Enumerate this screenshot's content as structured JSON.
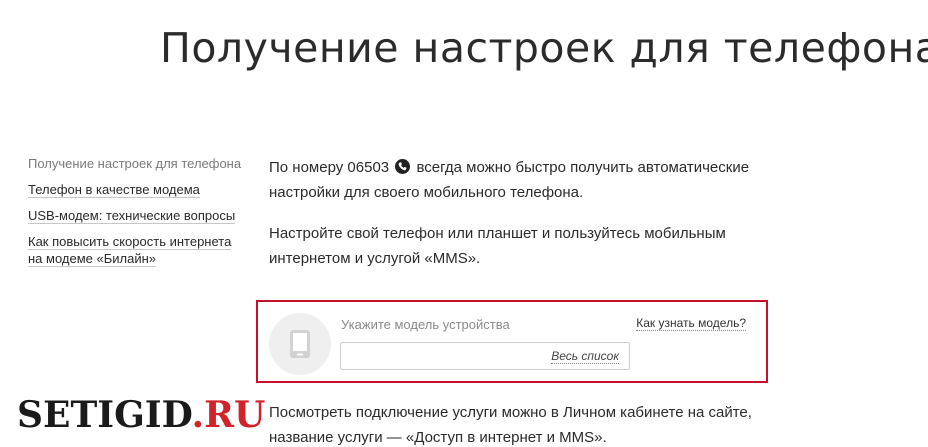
{
  "page": {
    "title": "Получение настроек для телефона"
  },
  "sidebar": {
    "items": [
      {
        "label": "Получение настроек для телефона",
        "active": true
      },
      {
        "label": "Телефон в качестве модема",
        "active": false
      },
      {
        "label": "USB-модем: технические вопросы",
        "active": false
      },
      {
        "label_line1": "Как повысить скорость интернета",
        "label_line2": "на модеме «Билайн»",
        "active": false
      }
    ]
  },
  "main": {
    "para1_before": "По номеру 06503",
    "para1_icon": "phone-icon",
    "para1_after": "всегда можно быстро получить автоматические",
    "para1_line2": "настройки для своего мобильного телефона.",
    "para2_line1": "Настройте свой телефон или планшет и пользуйтесь мобильным",
    "para2_line2": "интернетом и услугой «MMS»."
  },
  "chooser": {
    "icon": "smartphone-icon",
    "label": "Укажите модель устройства",
    "help_link": "Как узнать модель?",
    "input_value": "",
    "input_placeholder": "",
    "full_list_link": "Весь список",
    "border_color": "#c8102e"
  },
  "bottom": {
    "line1": "Посмотреть подключение услуги можно в Личном кабинете на сайте,",
    "line2": "название услуги — «Доступ в интернет и MMS»."
  },
  "watermark": {
    "part1": "SETIGID",
    "part2": ".RU",
    "color_main": "#1a1a1a",
    "color_accent": "#d2232a"
  }
}
